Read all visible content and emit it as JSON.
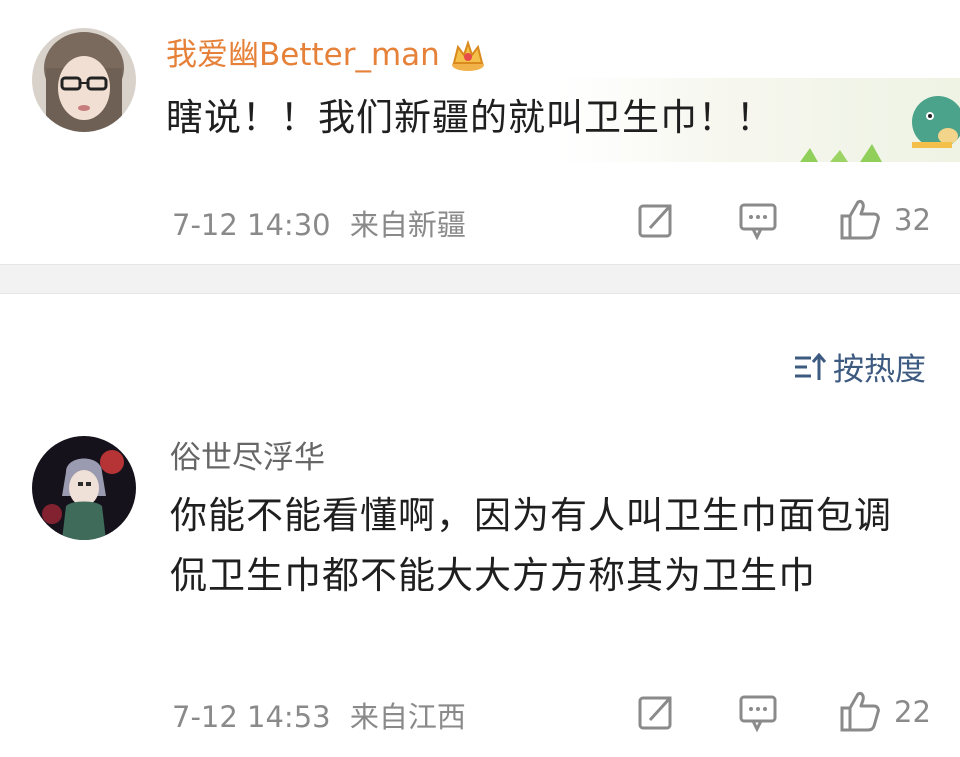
{
  "comments": [
    {
      "username": "我爱幽Better_man",
      "badge_icon": "crown-icon",
      "username_color": "#e6813a",
      "text": "瞎说！！我们新疆的就叫卫生巾！！",
      "time": "7-12 14:30",
      "location": "来自新疆",
      "likes": "32"
    },
    {
      "username": "俗世尽浮华",
      "username_color": "#666666",
      "text": "你能不能看懂啊，因为有人叫卫生巾面包调侃卫生巾都不能大大方方称其为卫生巾",
      "time": "7-12 14:53",
      "location": "来自江西",
      "likes": "22"
    }
  ],
  "sort": {
    "icon": "sort-icon",
    "label": "按热度"
  },
  "colors": {
    "link": "#3d5a80",
    "muted": "#8a8a8a",
    "divider": "#f2f2f2"
  }
}
